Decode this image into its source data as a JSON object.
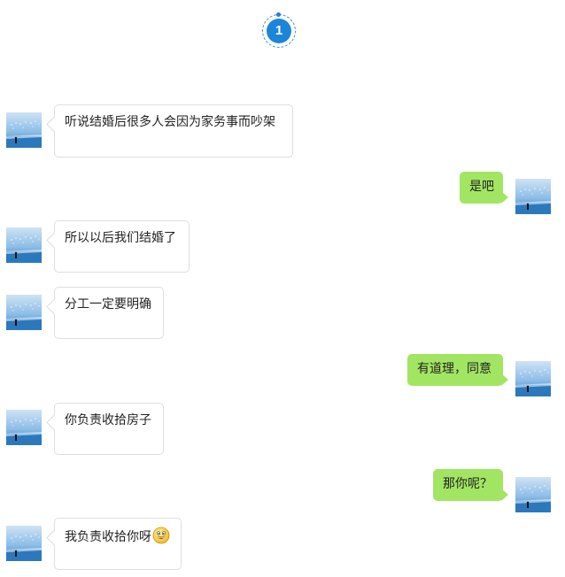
{
  "step": {
    "number": "1"
  },
  "messages": [
    {
      "side": "left",
      "text": "听说结婚后很多人会因为家务事而吵架"
    },
    {
      "side": "right",
      "text": "是吧"
    },
    {
      "side": "left",
      "text": "所以以后我们结婚了"
    },
    {
      "side": "left",
      "text": "分工一定要明确"
    },
    {
      "side": "right",
      "text": "有道理，同意"
    },
    {
      "side": "left",
      "text": "你负责收拾房子"
    },
    {
      "side": "right",
      "text": "那你呢？"
    },
    {
      "side": "left",
      "text": "我负责收拾你呀",
      "emoji": "grinning-face-emoji"
    }
  ],
  "colors": {
    "accent": "#1b86d8",
    "outgoing_bubble": "#a2e563",
    "incoming_bubble": "#ffffff",
    "incoming_border": "#dedede"
  }
}
